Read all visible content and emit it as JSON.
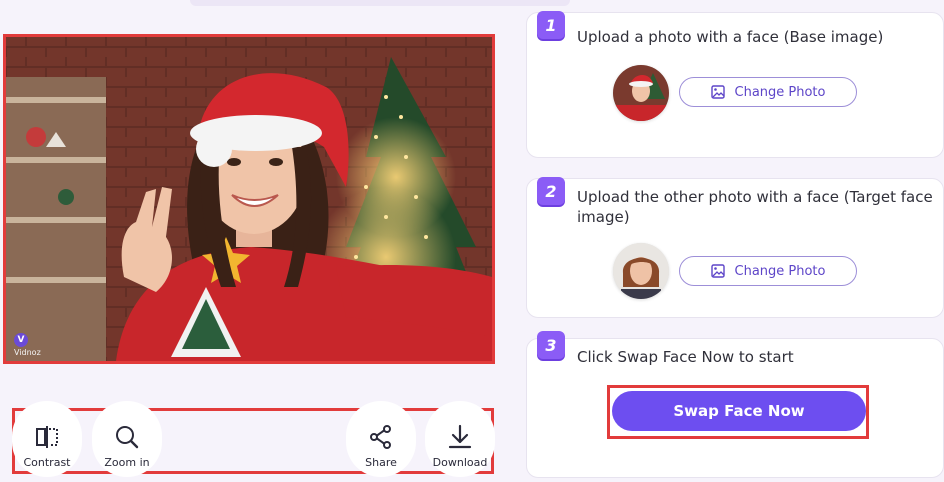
{
  "preview": {
    "watermark_badge": "V",
    "watermark_text": "Vidnoz"
  },
  "toolbar": {
    "contrast_label": "Contrast",
    "zoom_label": "Zoom in",
    "share_label": "Share",
    "download_label": "Download"
  },
  "steps": [
    {
      "number": "1",
      "text": "Upload a photo with a face (Base image)",
      "button_label": "Change Photo"
    },
    {
      "number": "2",
      "text": "Upload the other photo with a face (Target face image)",
      "button_label": "Change Photo"
    },
    {
      "number": "3",
      "text": "Click Swap Face Now to start",
      "button_label": "Swap Face Now"
    }
  ],
  "colors": {
    "accent": "#6d4ef0",
    "step_badge": "#8b5cf6",
    "highlight_border": "#e23b3b"
  }
}
